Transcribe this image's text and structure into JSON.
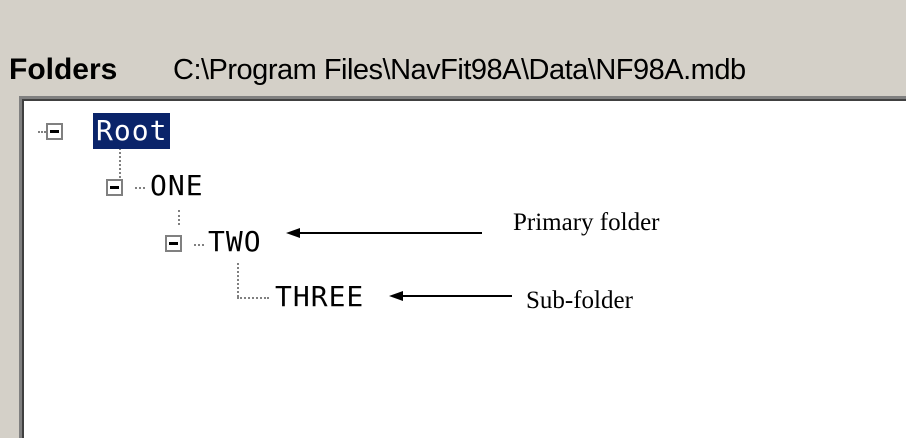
{
  "header": {
    "folders_label": "Folders",
    "db_path": "C:\\Program Files\\NavFit98A\\Data\\NF98A.mdb"
  },
  "tree": {
    "nodes": [
      {
        "label": "Root",
        "selected": true,
        "expander": "collapse-icon"
      },
      {
        "label": "ONE",
        "selected": false,
        "expander": "collapse-icon"
      },
      {
        "label": "TWO",
        "selected": false,
        "expander": "collapse-icon"
      },
      {
        "label": "THREE",
        "selected": false,
        "expander": "none"
      }
    ]
  },
  "annotations": {
    "primary_folder": "Primary folder",
    "sub_folder": "Sub-folder"
  },
  "colors": {
    "panel": "#d4d0c8",
    "selection": "#0a246a",
    "tree_line": "#808080"
  }
}
